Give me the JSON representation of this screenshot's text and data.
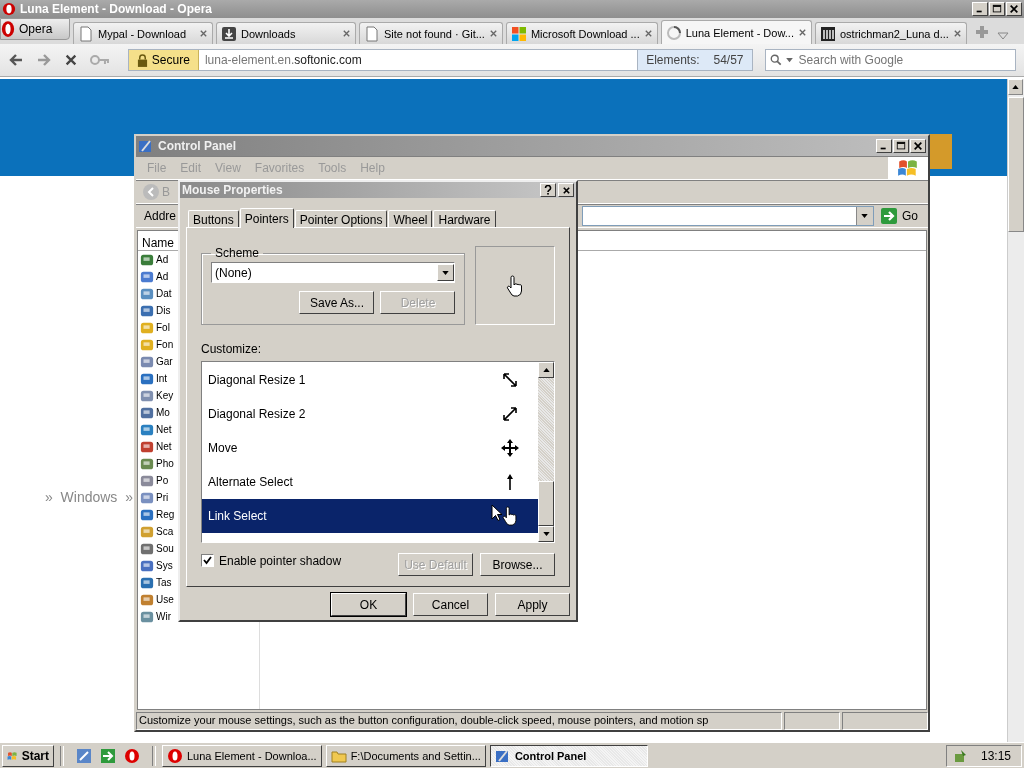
{
  "browser": {
    "title": "Luna Element - Download - Opera",
    "menu_button": "Opera",
    "tabs": [
      {
        "label": "Mypal - Download",
        "kind": "page",
        "selected": false
      },
      {
        "label": "Downloads",
        "kind": "download",
        "selected": false
      },
      {
        "label": "Site not found · Git...",
        "kind": "page",
        "selected": false
      },
      {
        "label": "Microsoft Download ...",
        "kind": "windows",
        "selected": false
      },
      {
        "label": "Luna Element - Dow...",
        "kind": "loading",
        "selected": true
      },
      {
        "label": "ostrichman2_Luna d...",
        "kind": "archive",
        "selected": false
      }
    ],
    "address": {
      "secure_label": "Secure",
      "url_host": "luna-element.en.",
      "url_domain": "softonic.com",
      "elements_label": "Elements:",
      "elements_count": "54/57"
    },
    "search": {
      "placeholder": "Search with Google"
    },
    "page": {
      "breadcrumb": "»  Windows  »"
    }
  },
  "control_panel": {
    "title": "Control Panel",
    "menu": [
      "File",
      "Edit",
      "View",
      "Favorites",
      "Tools",
      "Help"
    ],
    "back_label": "B",
    "address_label": "Addre",
    "go_label": "Go",
    "column_header": "Name",
    "items": [
      "Ad",
      "Ad",
      "Dat",
      "Dis",
      "Fol",
      "Fon",
      "Gar",
      "Int",
      "Key",
      "Mo",
      "Net",
      "Net",
      "Pho",
      "Po",
      "Pri",
      "Reg",
      "Sca",
      "Sou",
      "Sys",
      "Tas",
      "Use",
      "Wir"
    ],
    "status_text": "Customize your mouse settings, such as the button configuration, double-click speed, mouse pointers, and motion sp"
  },
  "dialog": {
    "title": "Mouse Properties",
    "tabs": [
      {
        "label": "Buttons",
        "selected": false
      },
      {
        "label": "Pointers",
        "selected": true
      },
      {
        "label": "Pointer Options",
        "selected": false
      },
      {
        "label": "Wheel",
        "selected": false
      },
      {
        "label": "Hardware",
        "selected": false
      }
    ],
    "scheme_label": "Scheme",
    "scheme_value": "(None)",
    "scheme_buttons": [
      {
        "label": "Save As...",
        "disabled": false
      },
      {
        "label": "Delete",
        "disabled": true
      }
    ],
    "customize_label": "Customize:",
    "pointers": [
      {
        "name": "Diagonal Resize 1",
        "kind": "diagonal1",
        "selected": false
      },
      {
        "name": "Diagonal Resize 2",
        "kind": "diagonal2",
        "selected": false
      },
      {
        "name": "Move",
        "kind": "move",
        "selected": false
      },
      {
        "name": "Alternate Select",
        "kind": "alternate",
        "selected": false
      },
      {
        "name": "Link Select",
        "kind": "link",
        "selected": true
      }
    ],
    "shadow": {
      "label": "Enable pointer shadow",
      "checked": true
    },
    "list_buttons": [
      {
        "label": "Use Default",
        "disabled": true
      },
      {
        "label": "Browse...",
        "disabled": false
      }
    ],
    "footer_buttons": [
      {
        "label": "OK",
        "disabled": false,
        "default": true
      },
      {
        "label": "Cancel",
        "disabled": false,
        "default": false
      },
      {
        "label": "Apply",
        "disabled": false,
        "default": false
      }
    ]
  },
  "taskbar": {
    "start": "Start",
    "tasks": [
      {
        "label": "Luna Element - Downloa...",
        "kind": "opera",
        "selected": false
      },
      {
        "label": "F:\\Documents and Settin...",
        "kind": "folder",
        "selected": false
      },
      {
        "label": "Control Panel",
        "kind": "control",
        "selected": true
      }
    ],
    "clock": "13:15"
  }
}
